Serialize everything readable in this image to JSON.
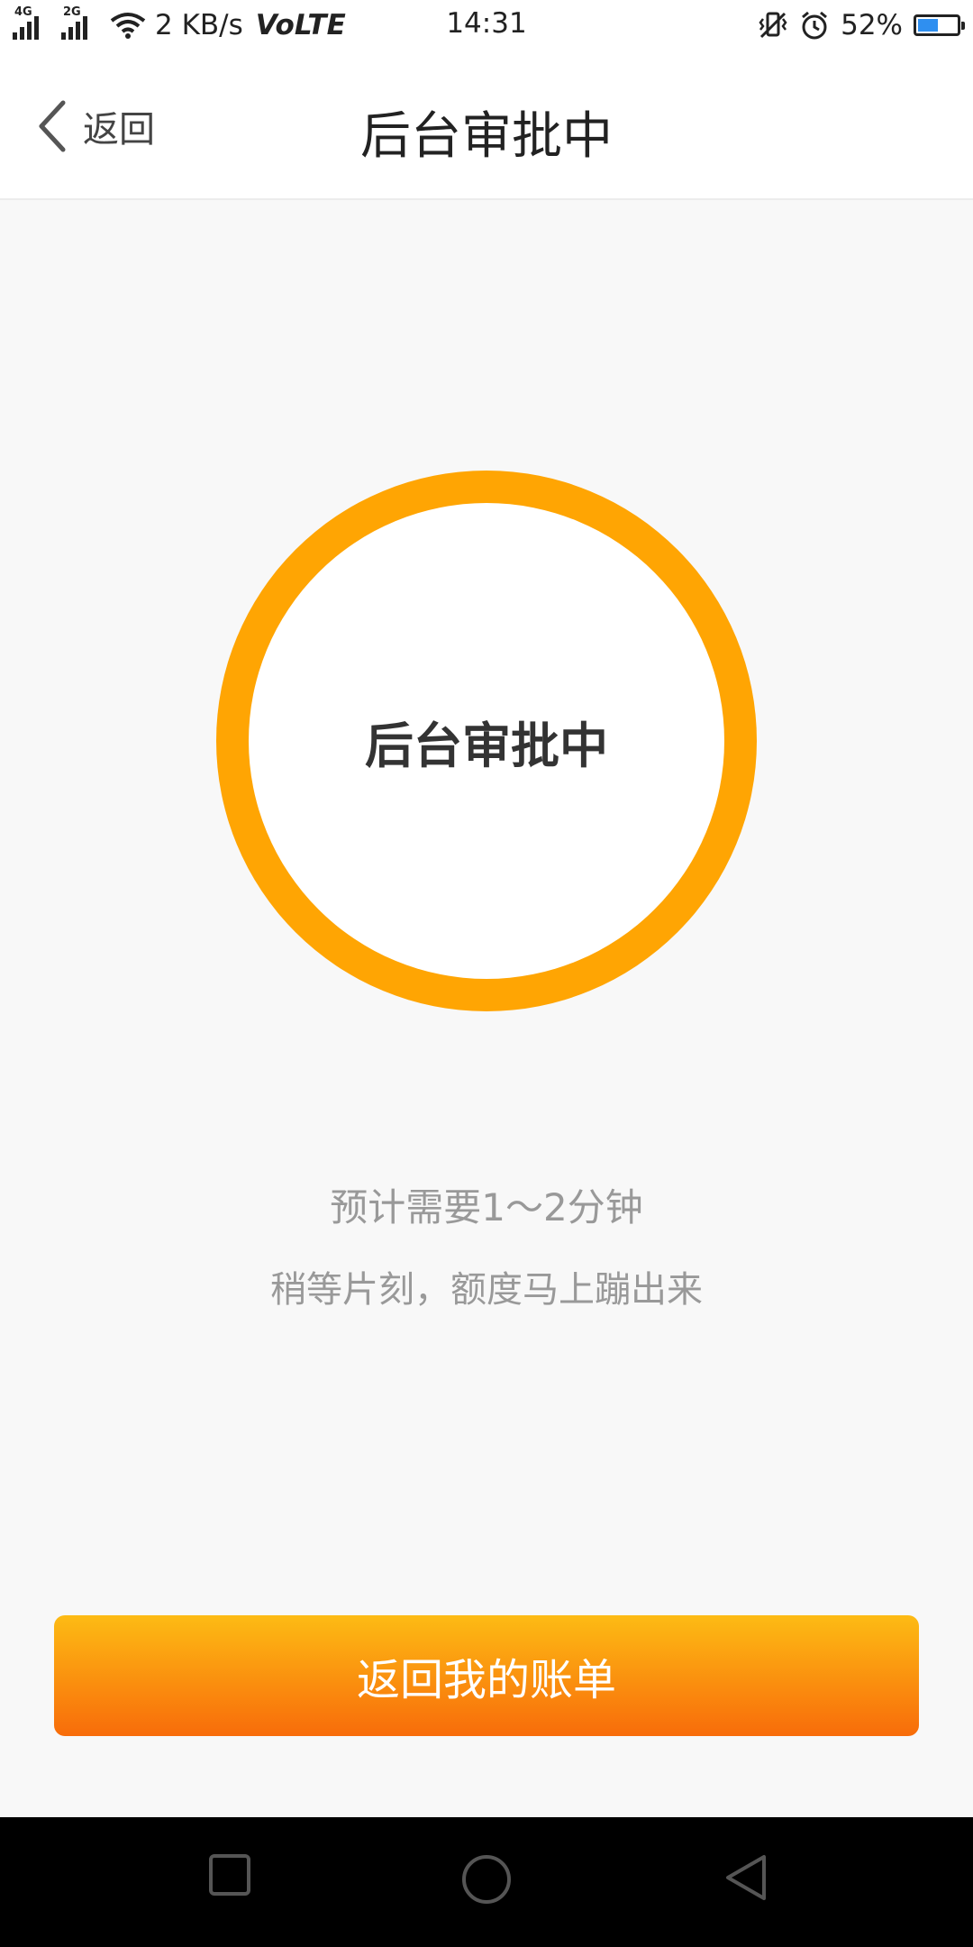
{
  "status_bar": {
    "net_gen_1": "4G",
    "net_gen_2": "2G",
    "speed": "2 KB/s",
    "volte": "VoLTE",
    "time": "14:31",
    "battery_percent": "52%",
    "battery_level": 0.52,
    "battery_color": "#2f8ff0",
    "icons": [
      "signal-icon",
      "wifi-icon",
      "vibrate-icon",
      "alarm-icon",
      "battery-icon"
    ]
  },
  "nav": {
    "back_label": "返回",
    "title": "后台审批中"
  },
  "status_ring": {
    "label": "后台审批中",
    "color": "#ffa503"
  },
  "hints": {
    "line1": "预计需要1～2分钟",
    "line2": "稍等片刻，额度马上蹦出来"
  },
  "primary_button": {
    "label": "返回我的账单",
    "gradient_top": "#fdbb14",
    "gradient_bottom": "#f86c0a"
  },
  "system_nav": {
    "icons": [
      "recent-apps-icon",
      "home-icon",
      "back-icon"
    ]
  }
}
